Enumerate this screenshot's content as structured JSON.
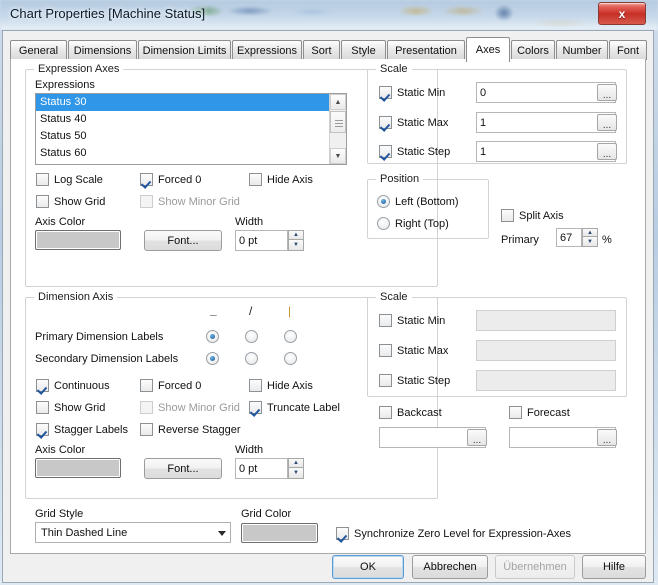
{
  "window": {
    "title": "Chart Properties [Machine Status]",
    "close_label": "x"
  },
  "tabs": {
    "items": [
      {
        "label": "General",
        "selected": false
      },
      {
        "label": "Dimensions",
        "selected": false
      },
      {
        "label": "Dimension Limits",
        "selected": false
      },
      {
        "label": "Expressions",
        "selected": false
      },
      {
        "label": "Sort",
        "selected": false
      },
      {
        "label": "Style",
        "selected": false
      },
      {
        "label": "Presentation",
        "selected": false
      },
      {
        "label": "Axes",
        "selected": true
      },
      {
        "label": "Colors",
        "selected": false
      },
      {
        "label": "Number",
        "selected": false
      },
      {
        "label": "Font",
        "selected": false
      }
    ],
    "nav_prev": "◄",
    "nav_next": "►"
  },
  "expression_axes": {
    "group_title": "Expression Axes",
    "expressions_label": "Expressions",
    "expressions": [
      {
        "label": "Status 30",
        "selected": true
      },
      {
        "label": "Status 40",
        "selected": false
      },
      {
        "label": "Status 50",
        "selected": false
      },
      {
        "label": "Status 60",
        "selected": false
      }
    ],
    "checks": [
      {
        "label": "Log Scale",
        "checked": false,
        "disabled": false
      },
      {
        "label": "Forced 0",
        "checked": true,
        "disabled": false
      },
      {
        "label": "Hide Axis",
        "checked": false,
        "disabled": false
      },
      {
        "label": "Show Grid",
        "checked": false,
        "disabled": false
      },
      {
        "label": "Show Minor Grid",
        "checked": false,
        "disabled": true
      }
    ],
    "axis_color_label": "Axis Color",
    "axis_color": "#c8c8c8",
    "font_button": "Font...",
    "width_label": "Width",
    "width_value": "0 pt",
    "scale": {
      "group_title": "Scale",
      "rows": [
        {
          "label": "Static Min",
          "checked": true,
          "value": "0",
          "ellipsis": "..."
        },
        {
          "label": "Static Max",
          "checked": true,
          "value": "1",
          "ellipsis": "..."
        },
        {
          "label": "Static Step",
          "checked": true,
          "value": "1",
          "ellipsis": "..."
        }
      ]
    },
    "position": {
      "group_title": "Position",
      "options": [
        {
          "label": "Left (Bottom)",
          "selected": true
        },
        {
          "label": "Right (Top)",
          "selected": false
        }
      ],
      "split_axis_label": "Split Axis",
      "split_axis_checked": false,
      "primary_label": "Primary",
      "primary_value": "67",
      "percent_sign": "%"
    }
  },
  "dimension_axis": {
    "group_title": "Dimension Axis",
    "orientation_headers": [
      "_",
      "/",
      "|"
    ],
    "label_rows": [
      {
        "label": "Primary Dimension Labels",
        "selected_index": 0
      },
      {
        "label": "Secondary Dimension Labels",
        "selected_index": 0
      }
    ],
    "checks": [
      {
        "label": "Continuous",
        "checked": true,
        "disabled": false
      },
      {
        "label": "Forced 0",
        "checked": false,
        "disabled": false
      },
      {
        "label": "Hide Axis",
        "checked": false,
        "disabled": false
      },
      {
        "label": "Show Grid",
        "checked": false,
        "disabled": false
      },
      {
        "label": "Show Minor Grid",
        "checked": false,
        "disabled": true
      },
      {
        "label": "Truncate Label",
        "checked": true,
        "disabled": false
      },
      {
        "label": "Stagger Labels",
        "checked": true,
        "disabled": false
      },
      {
        "label": "Reverse Stagger",
        "checked": false,
        "disabled": false
      }
    ],
    "axis_color_label": "Axis Color",
    "axis_color": "#c8c8c8",
    "font_button": "Font...",
    "width_label": "Width",
    "width_value": "0 pt",
    "scale": {
      "group_title": "Scale",
      "rows": [
        {
          "label": "Static Min",
          "checked": false,
          "value": ""
        },
        {
          "label": "Static Max",
          "checked": false,
          "value": ""
        },
        {
          "label": "Static Step",
          "checked": false,
          "value": ""
        }
      ]
    },
    "backcast": {
      "label": "Backcast",
      "checked": false,
      "value": "",
      "ellipsis": "..."
    },
    "forecast": {
      "label": "Forecast",
      "checked": false,
      "value": "",
      "ellipsis": "..."
    }
  },
  "grid": {
    "style_label": "Grid Style",
    "style_value": "Thin Dashed Line",
    "color_label": "Grid Color",
    "color": "#c8c8c8",
    "sync_label": "Synchronize Zero Level for Expression-Axes",
    "sync_checked": true
  },
  "buttons": {
    "ok": "OK",
    "cancel": "Abbrechen",
    "apply": "Übernehmen",
    "help": "Hilfe"
  }
}
